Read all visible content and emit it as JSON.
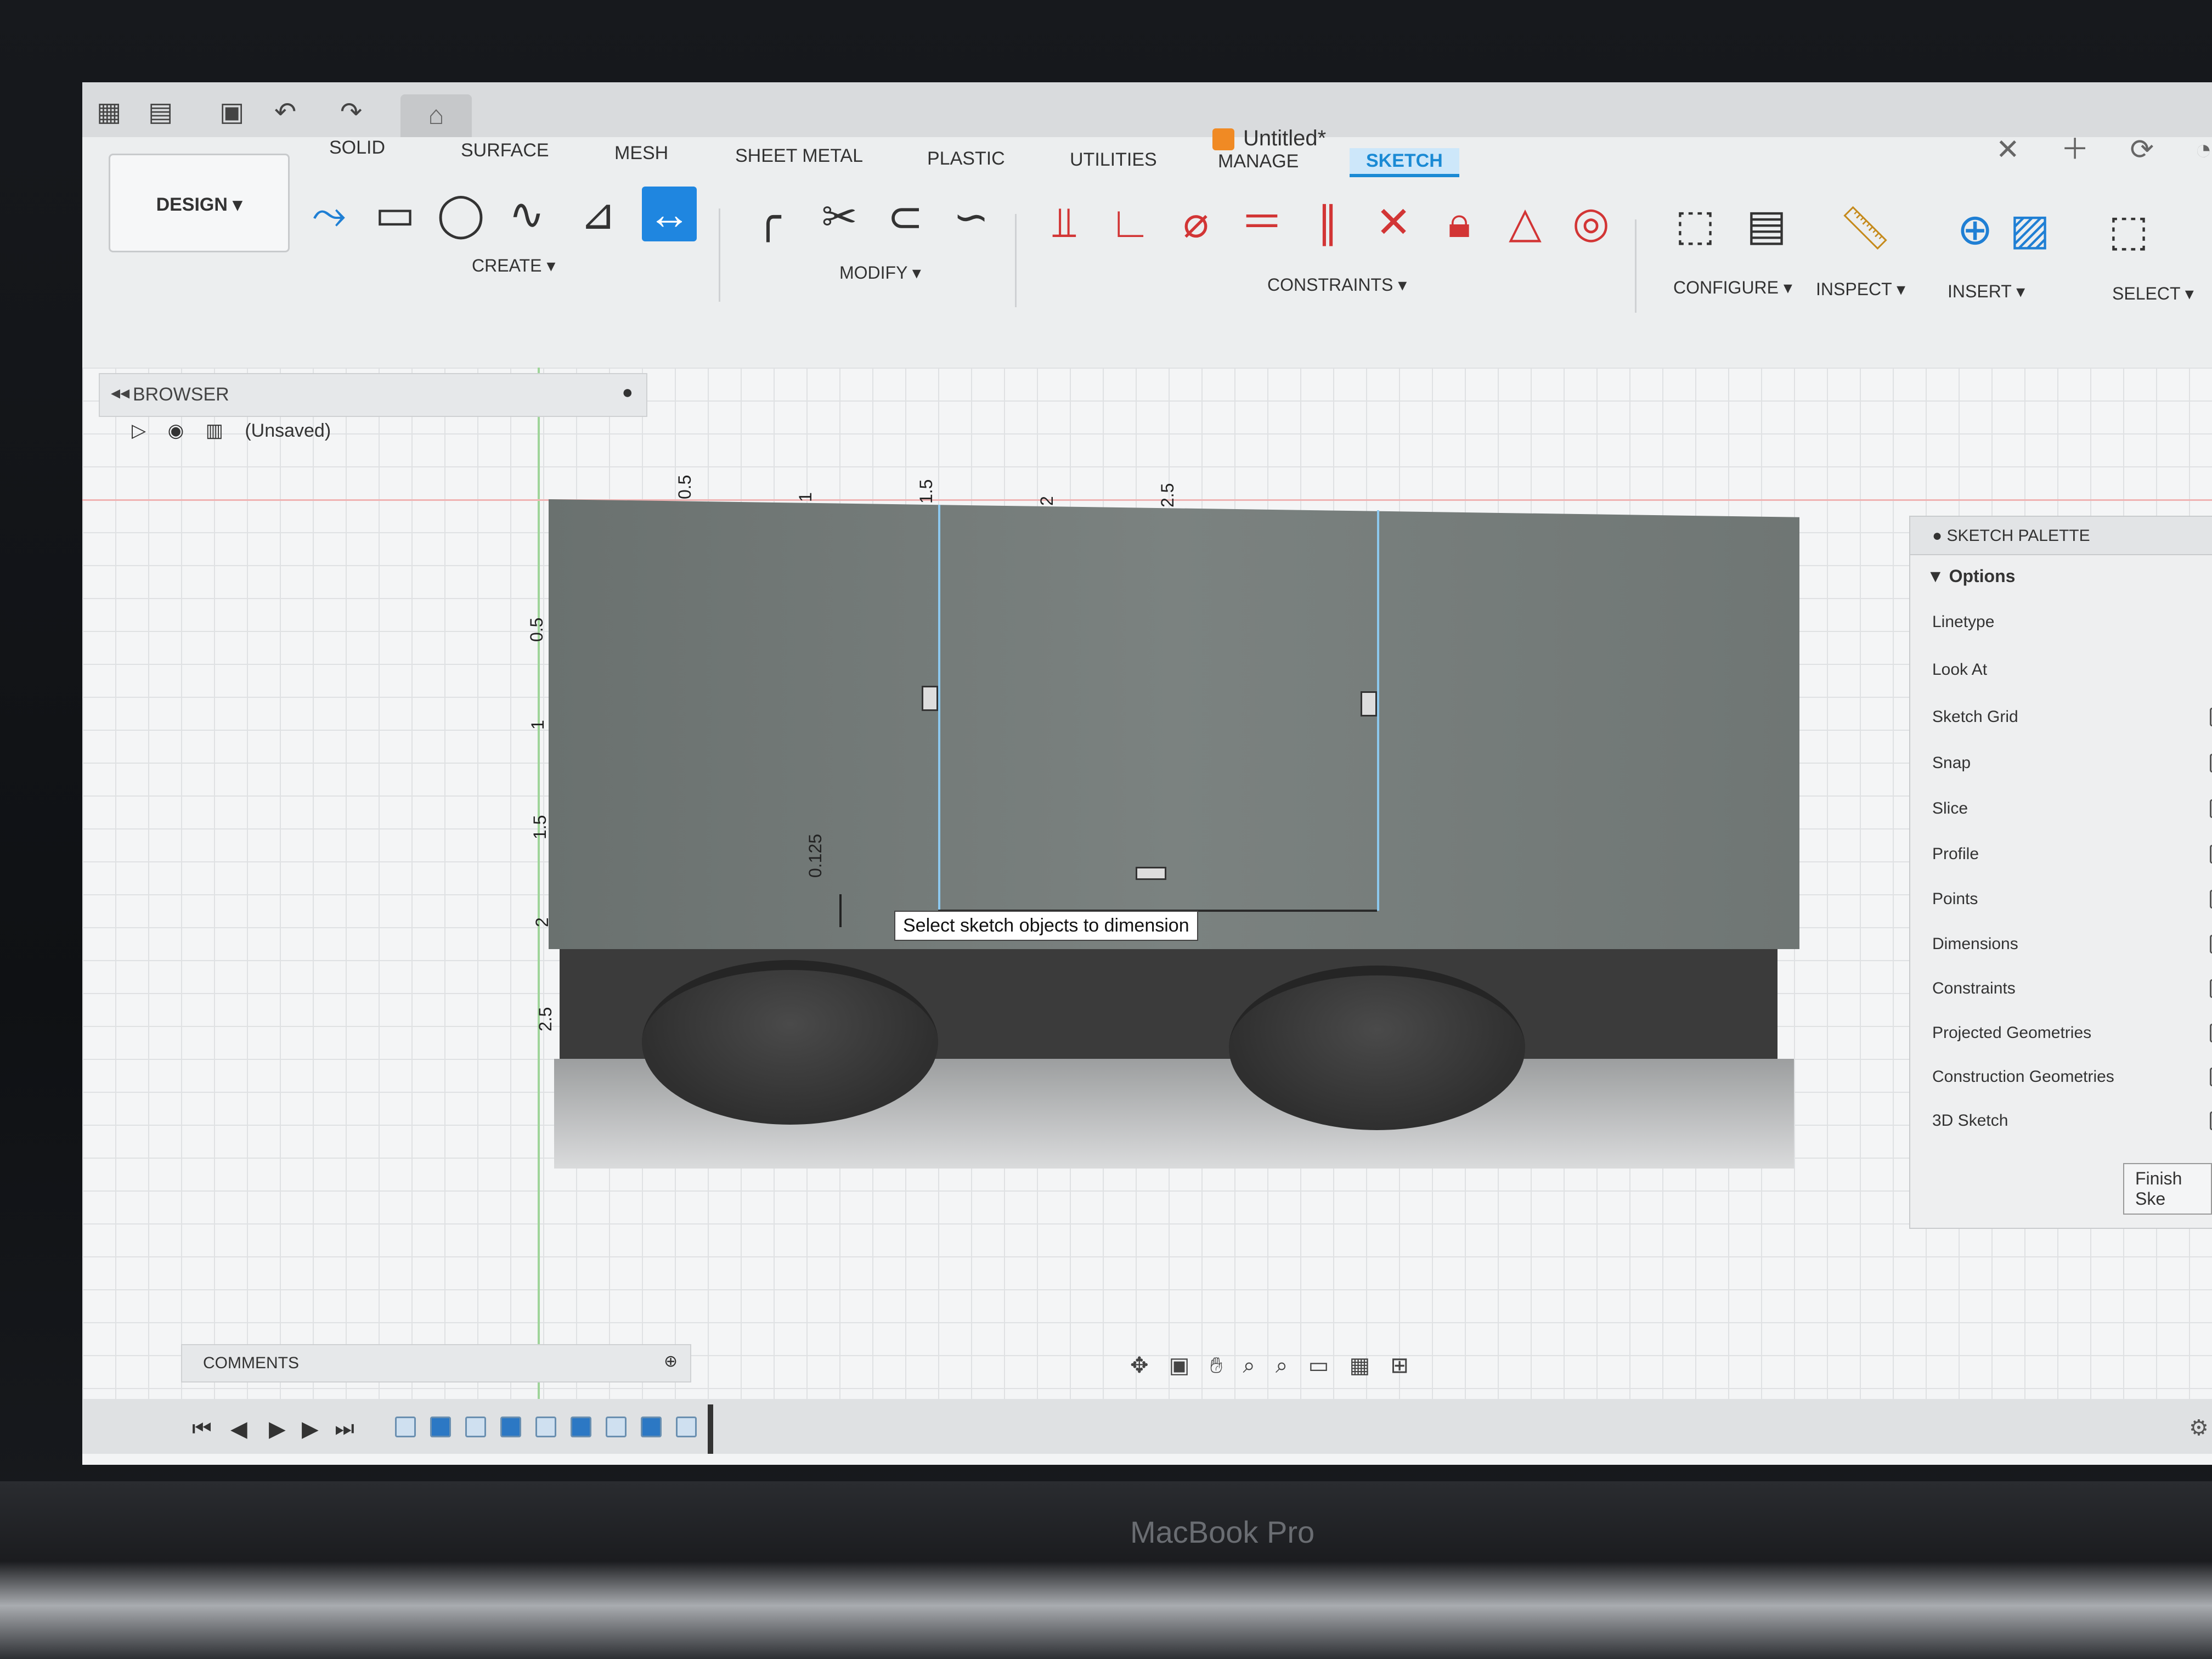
{
  "app": {
    "title": "Untitled*",
    "brand": "MacBook Pro"
  },
  "quick_access": {
    "icons": [
      "grid-icon",
      "file-icon",
      "save-icon",
      "undo-icon",
      "redo-icon",
      "home-icon"
    ]
  },
  "workspace": {
    "design_label": "DESIGN ▾"
  },
  "tabs": [
    {
      "label": "SOLID",
      "active": false
    },
    {
      "label": "SURFACE",
      "active": false
    },
    {
      "label": "MESH",
      "active": false
    },
    {
      "label": "SHEET METAL",
      "active": false
    },
    {
      "label": "PLASTIC",
      "active": false
    },
    {
      "label": "UTILITIES",
      "active": false
    },
    {
      "label": "MANAGE",
      "active": false
    },
    {
      "label": "SKETCH",
      "active": true
    }
  ],
  "tool_groups": {
    "create": "CREATE ▾",
    "modify": "MODIFY ▾",
    "constraints": "CONSTRAINTS ▾",
    "configure": "CONFIGURE ▾",
    "inspect": "INSPECT ▾",
    "insert": "INSERT ▾",
    "select": "SELECT ▾"
  },
  "browser": {
    "title": "BROWSER",
    "root_item": "(Unsaved)"
  },
  "ruler": {
    "x_ticks": [
      "0.5",
      "1",
      "1.5",
      "2",
      "2.5"
    ],
    "y_ticks": [
      "0.5",
      "1",
      "1.5",
      "2",
      "2.5"
    ]
  },
  "dimension": {
    "value": "0.125"
  },
  "tooltip": "Select sketch objects to dimension",
  "sketch_palette": {
    "title": "SKETCH PALETTE",
    "section": "Options",
    "rows": [
      {
        "label": "Linetype",
        "checked": null
      },
      {
        "label": "Look At",
        "checked": null
      },
      {
        "label": "Sketch Grid",
        "checked": true
      },
      {
        "label": "Snap",
        "checked": true
      },
      {
        "label": "Slice",
        "checked": false
      },
      {
        "label": "Profile",
        "checked": true
      },
      {
        "label": "Points",
        "checked": true
      },
      {
        "label": "Dimensions",
        "checked": true
      },
      {
        "label": "Constraints",
        "checked": true
      },
      {
        "label": "Projected Geometries",
        "checked": true
      },
      {
        "label": "Construction Geometries",
        "checked": true
      },
      {
        "label": "3D Sketch",
        "checked": false
      }
    ],
    "finish_button": "Finish Ske"
  },
  "comments": {
    "label": "COMMENTS"
  },
  "colors": {
    "accent": "#1a8ad4",
    "model": "#767d7b",
    "base": "#3b3b3b"
  }
}
